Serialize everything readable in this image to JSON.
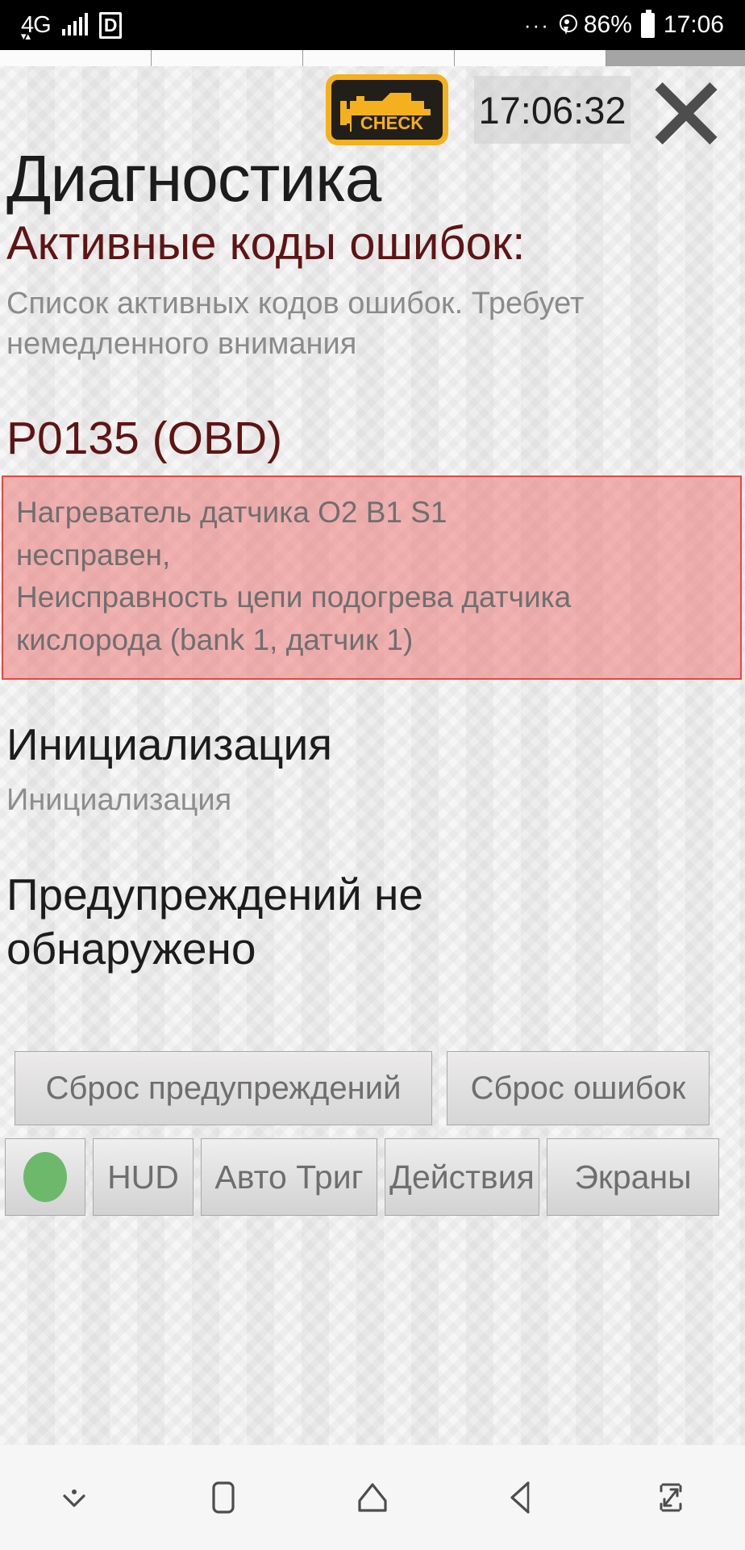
{
  "statusbar": {
    "network": "4G",
    "network_arrows": "▾▴",
    "carrier_badge": "D",
    "dots": "···",
    "battery_percent": "86%",
    "clock": "17:06",
    "icons": [
      "signal-bars-icon",
      "location-pin-icon",
      "battery-icon"
    ]
  },
  "header": {
    "check_engine_label": "CHECK",
    "session_clock": "17:06:32",
    "close_label": "✕"
  },
  "page": {
    "title": "Диагностика",
    "active_codes_heading": "Активные коды ошибок:",
    "active_codes_description": "Список активных кодов ошибок. Требует немедленного внимания",
    "fault": {
      "code": "P0135 (OBD)",
      "lines": [
        "Нагреватель датчика O2 B1 S1",
        "несправен,",
        "Неисправность цепи подогрева датчика",
        "кислорода (bank 1, датчик 1)"
      ]
    },
    "init_heading": "Инициализация",
    "init_value": "Инициализация",
    "no_warnings": "Предупреждений не обнаружено"
  },
  "actions": {
    "reset_warnings": "Сброс предупреждений",
    "reset_errors": "Сброс ошибок"
  },
  "toolbar": {
    "status_led": "green",
    "hud": "HUD",
    "auto_trigger": "Авто Триг",
    "actions": "Действия",
    "screens": "Экраны"
  },
  "navbar": {
    "items": [
      "collapse-chevron-icon",
      "recents-icon",
      "home-icon",
      "back-icon",
      "rotate-expand-icon"
    ]
  },
  "colors": {
    "accent_warning": "#f5b01d",
    "error_bg": "#f07373",
    "error_border": "#e8473f",
    "heading_red": "#5e1414",
    "led_green": "#6cb96c",
    "muted_text": "#8b8b8b"
  }
}
